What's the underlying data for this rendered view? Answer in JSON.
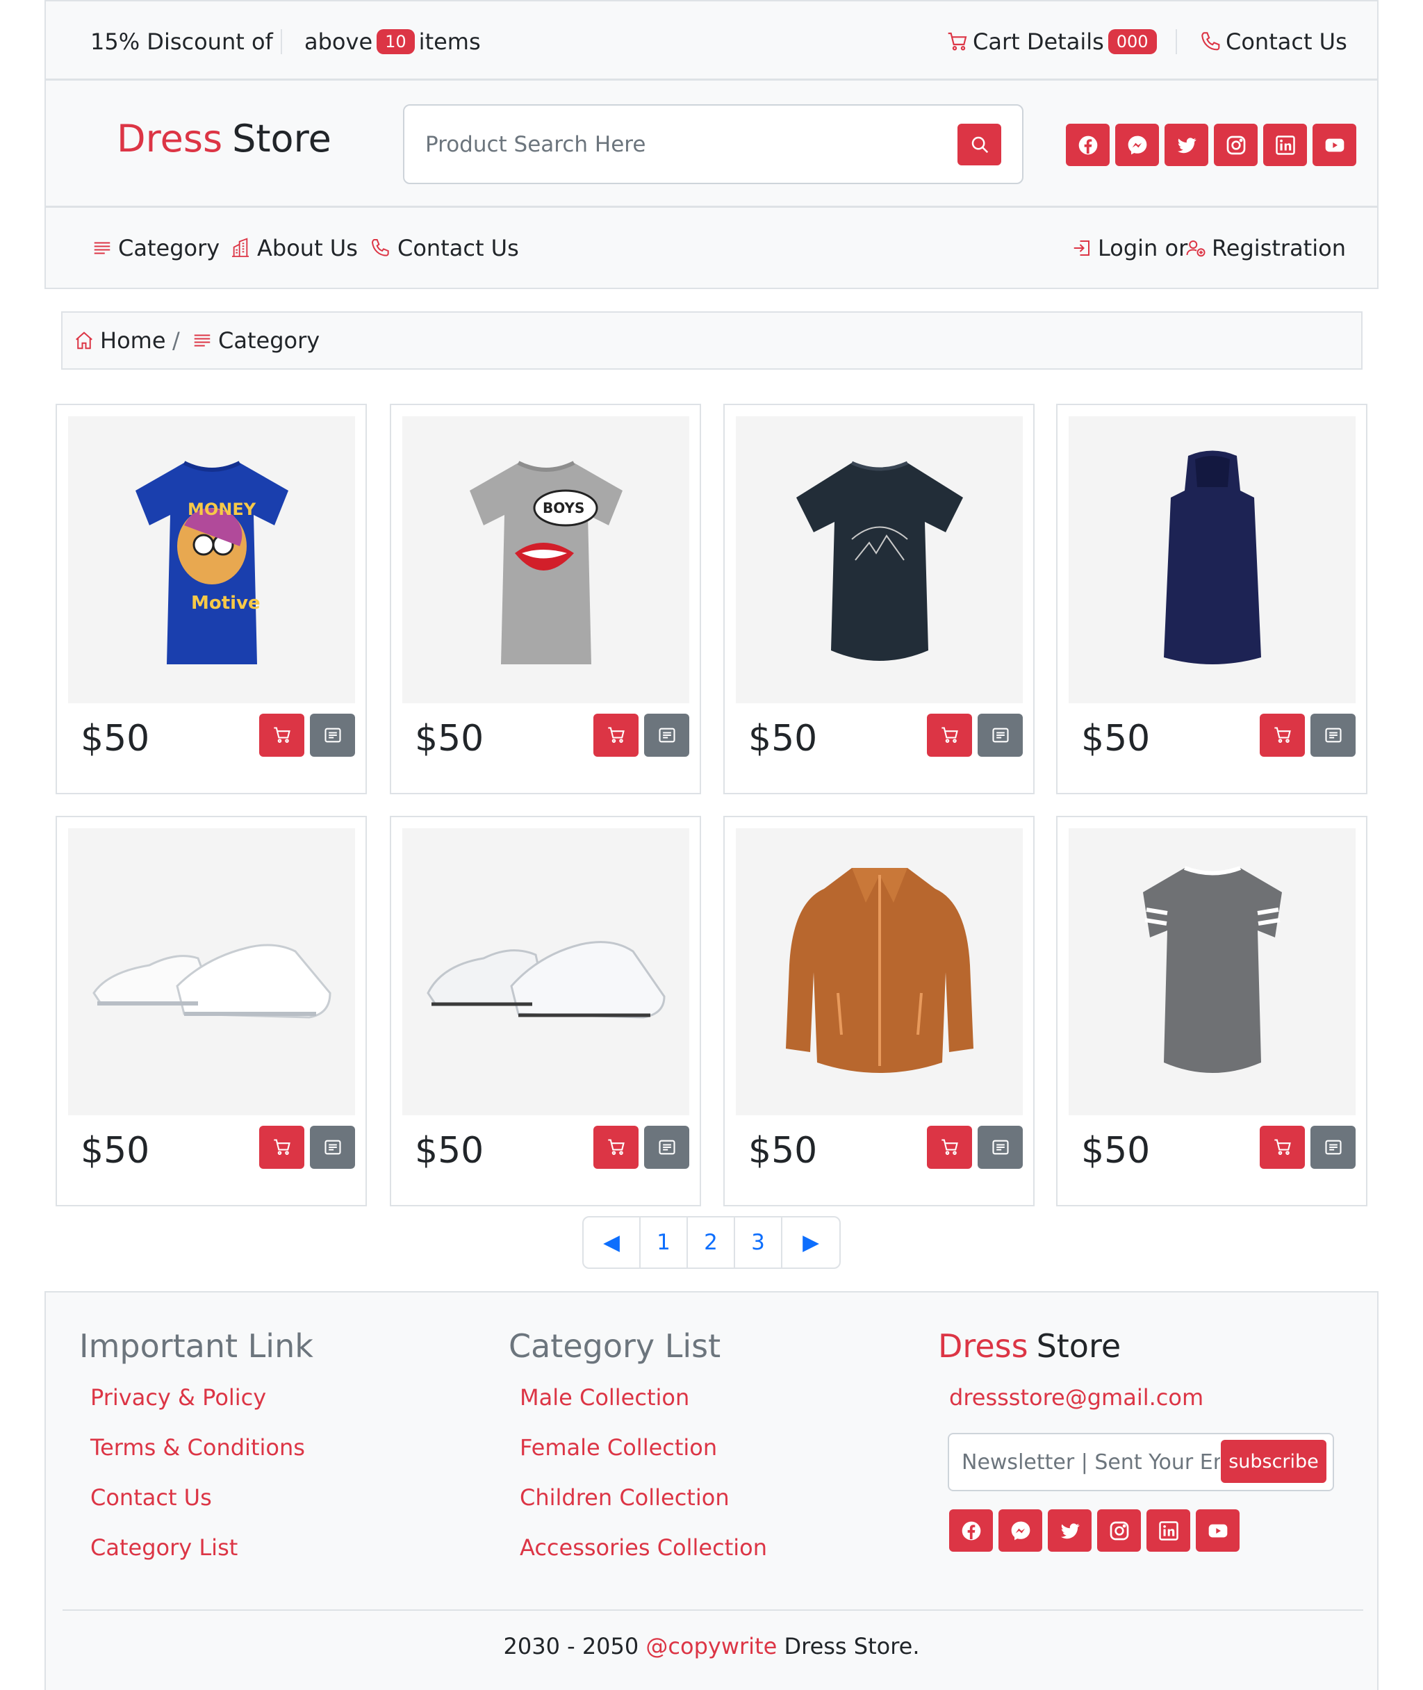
{
  "topbar": {
    "discount": "15% Discount of",
    "above": "above",
    "items_count": "10",
    "items": "items",
    "cart_label": "Cart Details",
    "cart_count": "000",
    "contact": "Contact Us"
  },
  "brand": {
    "first": "Dress",
    "second": "Store"
  },
  "search": {
    "placeholder": "Product Search Here"
  },
  "social": [
    "facebook-icon",
    "messenger-icon",
    "twitter-icon",
    "instagram-icon",
    "linkedin-icon",
    "youtube-icon"
  ],
  "nav": {
    "category": "Category",
    "about": "About Us",
    "contact": "Contact Us",
    "login": "Login or",
    "registration": "Registration"
  },
  "breadcrumb": {
    "home": "Home",
    "separator": "/",
    "category": "Category"
  },
  "products": [
    {
      "price": "$50",
      "image": "blue-graphic-tshirt"
    },
    {
      "price": "$50",
      "image": "grey-boys-lie-tshirt"
    },
    {
      "price": "$50",
      "image": "navy-let-the-outside-in-tshirt"
    },
    {
      "price": "$50",
      "image": "navy-hooded-sleeveless-dress"
    },
    {
      "price": "$50",
      "image": "white-sneakers"
    },
    {
      "price": "$50",
      "image": "white-cheer-shoes"
    },
    {
      "price": "$50",
      "image": "brown-fleece-jacket"
    },
    {
      "price": "$50",
      "image": "grey-tshirt-dress"
    }
  ],
  "pagination": {
    "prev": "◀",
    "pages": [
      "1",
      "2",
      "3"
    ],
    "next": "▶"
  },
  "footer": {
    "important_title": "Important Link",
    "important_links": [
      "Privacy & Policy",
      "Terms & Conditions",
      "Contact Us",
      "Category List"
    ],
    "category_title": "Category List",
    "category_links": [
      "Male Collection",
      "Female Collection",
      "Children Collection",
      "Accessories Collection"
    ],
    "brand_first": "Dress",
    "brand_second": "Store",
    "email": "dressstore@gmail.com",
    "newsletter_placeholder": "Newsletter | Sent Your Email",
    "subscribe": "subscribe",
    "copy_years": "2030 - 2050",
    "copy_link": "@copywrite",
    "copy_name": "Dress Store."
  },
  "colors": {
    "accent": "#dc3545",
    "secondary": "#6c757d",
    "link": "#0d6efd",
    "bar_bg": "#f8f9fa"
  }
}
